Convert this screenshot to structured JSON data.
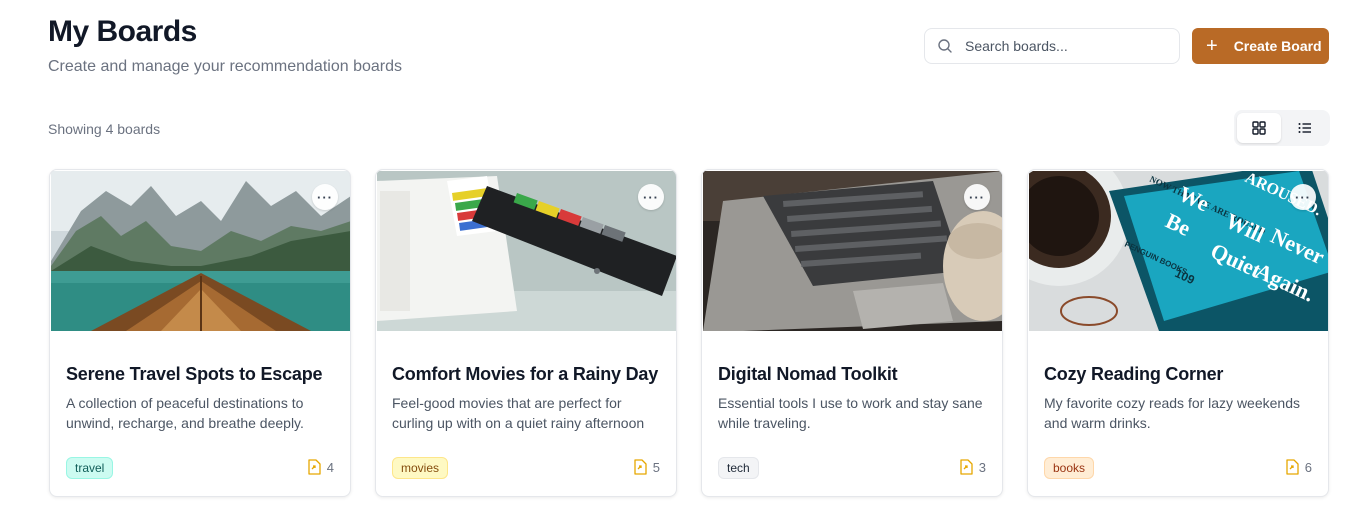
{
  "header": {
    "title": "My Boards",
    "subtitle": "Create and manage your recommendation boards"
  },
  "search": {
    "placeholder": "Search boards...",
    "value": "",
    "icon": "search-icon"
  },
  "create_button": {
    "label": "Create Board",
    "icon": "plus-icon"
  },
  "showing_text": "Showing 4 boards",
  "view_toggle": {
    "options": [
      "grid",
      "list"
    ],
    "selected": "grid"
  },
  "colors": {
    "accent": "#b96a26",
    "count_icon": "#e6a700"
  },
  "boards": [
    {
      "title": "Serene Travel Spots to Escape",
      "description": "A collection of peaceful destinations to unwind, recharge, and breathe deeply.",
      "tag": "travel",
      "tag_colors": {
        "bg": "#ccfbf1",
        "border": "#99f6e4",
        "text": "#115e59"
      },
      "count": "4",
      "image": "mountain-lake-boat"
    },
    {
      "title": "Comfort Movies for a Rainy Day",
      "description": "Feel-good movies that are perfect for curling up with on a quiet rainy afternoon",
      "tag": "movies",
      "tag_colors": {
        "bg": "#fef9c3",
        "border": "#fde68a",
        "text": "#854d0e"
      },
      "count": "5",
      "image": "film-clapperboard"
    },
    {
      "title": "Digital Nomad Toolkit",
      "description": "Essential tools I use to work and stay sane while traveling.",
      "tag": "tech",
      "tag_colors": {
        "bg": "#f3f4f6",
        "border": "#e5e7eb",
        "text": "#1f2937"
      },
      "count": "3",
      "image": "laptop-coffee"
    },
    {
      "title": "Cozy Reading Corner",
      "description": "My favorite cozy reads for lazy weekends and warm drinks.",
      "tag": "books",
      "tag_colors": {
        "bg": "#ffedd5",
        "border": "#fed7aa",
        "text": "#9a3412"
      },
      "count": "6",
      "image": "book-and-coffee",
      "image_text": [
        "We",
        "Be",
        "Will",
        "Quiet",
        "Never",
        "Again.",
        "109",
        "PENGUIN BOOKS",
        "AROUSED.",
        "NOW THAT WE ARE ROUSED"
      ]
    }
  ]
}
